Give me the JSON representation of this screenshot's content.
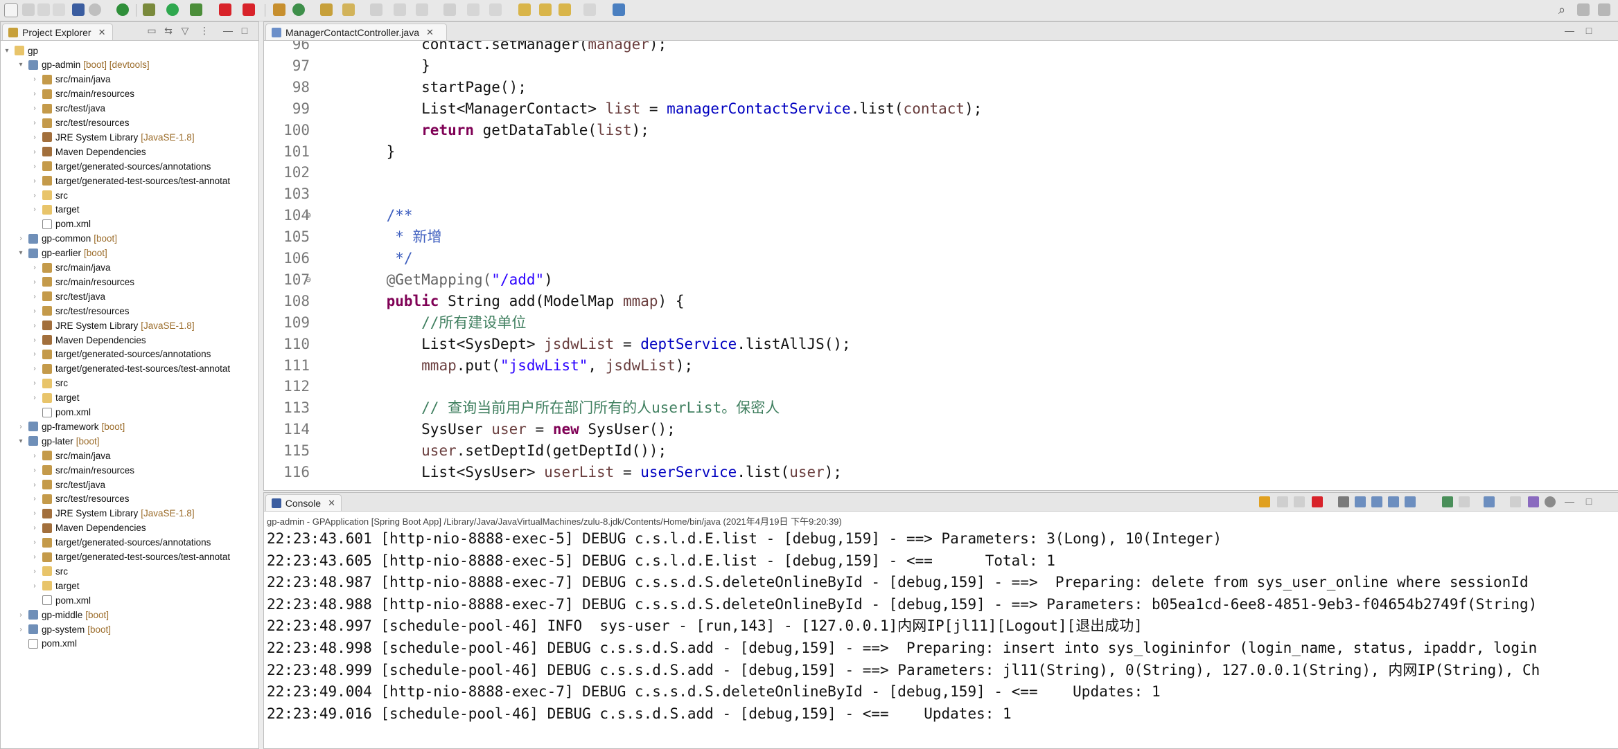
{
  "explorer": {
    "tab_label": "Project Explorer",
    "close_glyph": "✕",
    "items": [
      {
        "depth": 0,
        "twist": "▾",
        "icon": "i-folder",
        "text": "gp",
        "deco": ""
      },
      {
        "depth": 1,
        "twist": "▾",
        "icon": "i-proj",
        "text": "gp-admin",
        "deco": "[boot] [devtools]"
      },
      {
        "depth": 2,
        "twist": "›",
        "icon": "i-src",
        "text": "src/main/java",
        "deco": ""
      },
      {
        "depth": 2,
        "twist": "›",
        "icon": "i-src",
        "text": "src/main/resources",
        "deco": ""
      },
      {
        "depth": 2,
        "twist": "›",
        "icon": "i-src",
        "text": "src/test/java",
        "deco": ""
      },
      {
        "depth": 2,
        "twist": "›",
        "icon": "i-src",
        "text": "src/test/resources",
        "deco": ""
      },
      {
        "depth": 2,
        "twist": "›",
        "icon": "i-lib",
        "text": "JRE System Library",
        "deco": "[JavaSE-1.8]"
      },
      {
        "depth": 2,
        "twist": "›",
        "icon": "i-lib",
        "text": "Maven Dependencies",
        "deco": ""
      },
      {
        "depth": 2,
        "twist": "›",
        "icon": "i-src",
        "text": "target/generated-sources/annotations",
        "deco": ""
      },
      {
        "depth": 2,
        "twist": "›",
        "icon": "i-src",
        "text": "target/generated-test-sources/test-annotat",
        "deco": ""
      },
      {
        "depth": 2,
        "twist": "›",
        "icon": "i-folder",
        "text": "src",
        "deco": ""
      },
      {
        "depth": 2,
        "twist": "›",
        "icon": "i-folder",
        "text": "target",
        "deco": ""
      },
      {
        "depth": 2,
        "twist": "",
        "icon": "i-file",
        "text": "pom.xml",
        "deco": ""
      },
      {
        "depth": 1,
        "twist": "›",
        "icon": "i-proj",
        "text": "gp-common",
        "deco": "[boot]"
      },
      {
        "depth": 1,
        "twist": "▾",
        "icon": "i-proj",
        "text": "gp-earlier",
        "deco": "[boot]"
      },
      {
        "depth": 2,
        "twist": "›",
        "icon": "i-src",
        "text": "src/main/java",
        "deco": ""
      },
      {
        "depth": 2,
        "twist": "›",
        "icon": "i-src",
        "text": "src/main/resources",
        "deco": ""
      },
      {
        "depth": 2,
        "twist": "›",
        "icon": "i-src",
        "text": "src/test/java",
        "deco": ""
      },
      {
        "depth": 2,
        "twist": "›",
        "icon": "i-src",
        "text": "src/test/resources",
        "deco": ""
      },
      {
        "depth": 2,
        "twist": "›",
        "icon": "i-lib",
        "text": "JRE System Library",
        "deco": "[JavaSE-1.8]"
      },
      {
        "depth": 2,
        "twist": "›",
        "icon": "i-lib",
        "text": "Maven Dependencies",
        "deco": ""
      },
      {
        "depth": 2,
        "twist": "›",
        "icon": "i-src",
        "text": "target/generated-sources/annotations",
        "deco": ""
      },
      {
        "depth": 2,
        "twist": "›",
        "icon": "i-src",
        "text": "target/generated-test-sources/test-annotat",
        "deco": ""
      },
      {
        "depth": 2,
        "twist": "›",
        "icon": "i-folder",
        "text": "src",
        "deco": ""
      },
      {
        "depth": 2,
        "twist": "›",
        "icon": "i-folder",
        "text": "target",
        "deco": ""
      },
      {
        "depth": 2,
        "twist": "",
        "icon": "i-file",
        "text": "pom.xml",
        "deco": ""
      },
      {
        "depth": 1,
        "twist": "›",
        "icon": "i-proj",
        "text": "gp-framework",
        "deco": "[boot]"
      },
      {
        "depth": 1,
        "twist": "▾",
        "icon": "i-proj",
        "text": "gp-later",
        "deco": "[boot]"
      },
      {
        "depth": 2,
        "twist": "›",
        "icon": "i-src",
        "text": "src/main/java",
        "deco": ""
      },
      {
        "depth": 2,
        "twist": "›",
        "icon": "i-src",
        "text": "src/main/resources",
        "deco": ""
      },
      {
        "depth": 2,
        "twist": "›",
        "icon": "i-src",
        "text": "src/test/java",
        "deco": ""
      },
      {
        "depth": 2,
        "twist": "›",
        "icon": "i-src",
        "text": "src/test/resources",
        "deco": ""
      },
      {
        "depth": 2,
        "twist": "›",
        "icon": "i-lib",
        "text": "JRE System Library",
        "deco": "[JavaSE-1.8]"
      },
      {
        "depth": 2,
        "twist": "›",
        "icon": "i-lib",
        "text": "Maven Dependencies",
        "deco": ""
      },
      {
        "depth": 2,
        "twist": "›",
        "icon": "i-src",
        "text": "target/generated-sources/annotations",
        "deco": ""
      },
      {
        "depth": 2,
        "twist": "›",
        "icon": "i-src",
        "text": "target/generated-test-sources/test-annotat",
        "deco": ""
      },
      {
        "depth": 2,
        "twist": "›",
        "icon": "i-folder",
        "text": "src",
        "deco": ""
      },
      {
        "depth": 2,
        "twist": "›",
        "icon": "i-folder",
        "text": "target",
        "deco": ""
      },
      {
        "depth": 2,
        "twist": "",
        "icon": "i-file",
        "text": "pom.xml",
        "deco": ""
      },
      {
        "depth": 1,
        "twist": "›",
        "icon": "i-proj",
        "text": "gp-middle",
        "deco": "[boot]"
      },
      {
        "depth": 1,
        "twist": "›",
        "icon": "i-proj",
        "text": "gp-system",
        "deco": "[boot]"
      },
      {
        "depth": 1,
        "twist": "",
        "icon": "i-file",
        "text": "pom.xml",
        "deco": ""
      }
    ]
  },
  "editor": {
    "tab_label": "ManagerContactController.java",
    "close_glyph": "✕",
    "lines": [
      {
        "n": "96",
        "fold": "",
        "tokens": [
          {
            "t": "        contact.setManager(",
            "c": ""
          },
          {
            "t": "manager",
            "c": "var"
          },
          {
            "t": ");",
            "c": ""
          }
        ]
      },
      {
        "n": "97",
        "fold": "",
        "tokens": [
          {
            "t": "        }",
            "c": ""
          }
        ]
      },
      {
        "n": "98",
        "fold": "",
        "tokens": [
          {
            "t": "        startPage();",
            "c": ""
          }
        ]
      },
      {
        "n": "99",
        "fold": "",
        "tokens": [
          {
            "t": "        List<ManagerContact> ",
            "c": ""
          },
          {
            "t": "list",
            "c": "var"
          },
          {
            "t": " = ",
            "c": ""
          },
          {
            "t": "managerContactService",
            "c": "fld"
          },
          {
            "t": ".list(",
            "c": ""
          },
          {
            "t": "contact",
            "c": "var"
          },
          {
            "t": ");",
            "c": ""
          }
        ]
      },
      {
        "n": "100",
        "fold": "",
        "tokens": [
          {
            "t": "        ",
            "c": ""
          },
          {
            "t": "return",
            "c": "kw"
          },
          {
            "t": " getDataTable(",
            "c": ""
          },
          {
            "t": "list",
            "c": "var"
          },
          {
            "t": ");",
            "c": ""
          }
        ]
      },
      {
        "n": "101",
        "fold": "",
        "tokens": [
          {
            "t": "    }",
            "c": ""
          }
        ]
      },
      {
        "n": "102",
        "fold": "",
        "tokens": []
      },
      {
        "n": "103",
        "fold": "",
        "tokens": []
      },
      {
        "n": "104",
        "fold": "⊖",
        "tokens": [
          {
            "t": "    /**",
            "c": "jd"
          }
        ]
      },
      {
        "n": "105",
        "fold": "",
        "tokens": [
          {
            "t": "     * 新增",
            "c": "jd"
          }
        ]
      },
      {
        "n": "106",
        "fold": "",
        "tokens": [
          {
            "t": "     */",
            "c": "jd"
          }
        ]
      },
      {
        "n": "107",
        "fold": "⊖",
        "tokens": [
          {
            "t": "    @GetMapping(",
            "c": "ann"
          },
          {
            "t": "\"/add\"",
            "c": "str"
          },
          {
            "t": ")",
            "c": ""
          }
        ]
      },
      {
        "n": "108",
        "fold": "",
        "tokens": [
          {
            "t": "    ",
            "c": ""
          },
          {
            "t": "public",
            "c": "kw"
          },
          {
            "t": " String add(ModelMap ",
            "c": ""
          },
          {
            "t": "mmap",
            "c": "var"
          },
          {
            "t": ") {",
            "c": ""
          }
        ]
      },
      {
        "n": "109",
        "fold": "",
        "tokens": [
          {
            "t": "        //所有建设单位",
            "c": "cm"
          }
        ]
      },
      {
        "n": "110",
        "fold": "",
        "tokens": [
          {
            "t": "        List<SysDept> ",
            "c": ""
          },
          {
            "t": "jsdwList",
            "c": "var"
          },
          {
            "t": " = ",
            "c": ""
          },
          {
            "t": "deptService",
            "c": "fld"
          },
          {
            "t": ".listAllJS();",
            "c": ""
          }
        ]
      },
      {
        "n": "111",
        "fold": "",
        "tokens": [
          {
            "t": "        ",
            "c": ""
          },
          {
            "t": "mmap",
            "c": "var"
          },
          {
            "t": ".put(",
            "c": ""
          },
          {
            "t": "\"jsdwList\"",
            "c": "str"
          },
          {
            "t": ", ",
            "c": ""
          },
          {
            "t": "jsdwList",
            "c": "var"
          },
          {
            "t": ");",
            "c": ""
          }
        ]
      },
      {
        "n": "112",
        "fold": "",
        "tokens": []
      },
      {
        "n": "113",
        "fold": "",
        "tokens": [
          {
            "t": "        // 查询当前用户所在部门所有的人userList。保密人",
            "c": "cm"
          }
        ]
      },
      {
        "n": "114",
        "fold": "",
        "tokens": [
          {
            "t": "        SysUser ",
            "c": ""
          },
          {
            "t": "user",
            "c": "var"
          },
          {
            "t": " = ",
            "c": ""
          },
          {
            "t": "new",
            "c": "kw"
          },
          {
            "t": " SysUser();",
            "c": ""
          }
        ]
      },
      {
        "n": "115",
        "fold": "",
        "tokens": [
          {
            "t": "        ",
            "c": ""
          },
          {
            "t": "user",
            "c": "var"
          },
          {
            "t": ".setDeptId(getDeptId());",
            "c": ""
          }
        ]
      },
      {
        "n": "116",
        "fold": "",
        "tokens": [
          {
            "t": "        List<SysUser> ",
            "c": ""
          },
          {
            "t": "userList",
            "c": "var"
          },
          {
            "t": " = ",
            "c": ""
          },
          {
            "t": "userService",
            "c": "fld"
          },
          {
            "t": ".list(",
            "c": ""
          },
          {
            "t": "user",
            "c": "var"
          },
          {
            "t": ");",
            "c": ""
          }
        ]
      }
    ]
  },
  "console": {
    "tab_label": "Console",
    "close_glyph": "✕",
    "info": "gp-admin - GPApplication [Spring Boot App] /Library/Java/JavaVirtualMachines/zulu-8.jdk/Contents/Home/bin/java  (2021年4月19日 下午9:20:39)",
    "lines": [
      "22:23:43.601 [http-nio-8888-exec-5] DEBUG c.s.l.d.E.list - [debug,159] - ==> Parameters: 3(Long), 10(Integer)",
      "22:23:43.605 [http-nio-8888-exec-5] DEBUG c.s.l.d.E.list - [debug,159] - <==      Total: 1",
      "22:23:48.987 [http-nio-8888-exec-7] DEBUG c.s.s.d.S.deleteOnlineById - [debug,159] - ==>  Preparing: delete from sys_user_online where sessionId",
      "22:23:48.988 [http-nio-8888-exec-7] DEBUG c.s.s.d.S.deleteOnlineById - [debug,159] - ==> Parameters: b05ea1cd-6ee8-4851-9eb3-f04654b2749f(String)",
      "22:23:48.997 [schedule-pool-46] INFO  sys-user - [run,143] - [127.0.0.1]内网IP[jl11][Logout][退出成功]",
      "22:23:48.998 [schedule-pool-46] DEBUG c.s.s.d.S.add - [debug,159] - ==>  Preparing: insert into sys_logininfor (login_name, status, ipaddr, login",
      "22:23:48.999 [schedule-pool-46] DEBUG c.s.s.d.S.add - [debug,159] - ==> Parameters: jl11(String), 0(String), 127.0.0.1(String), 内网IP(String), Ch",
      "22:23:49.004 [http-nio-8888-exec-7] DEBUG c.s.s.d.S.deleteOnlineById - [debug,159] - <==    Updates: 1",
      "22:23:49.016 [schedule-pool-46] DEBUG c.s.s.d.S.add - [debug,159] - <==    Updates: 1"
    ]
  },
  "toolbar": {
    "search_glyph": "⌕"
  }
}
